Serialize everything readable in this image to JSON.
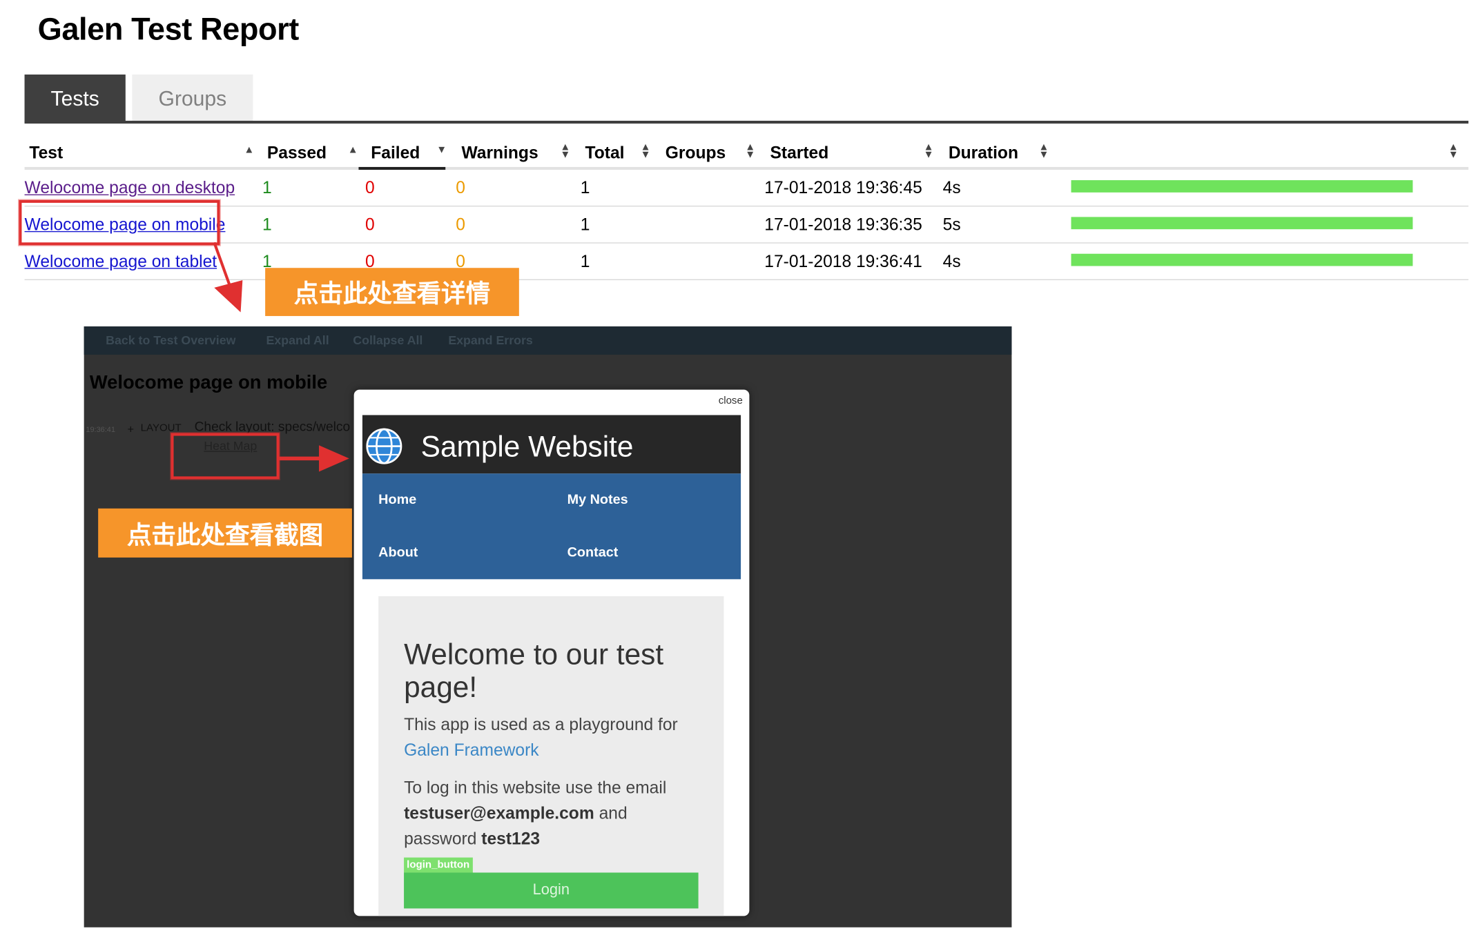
{
  "report": {
    "title": "Galen Test Report"
  },
  "tabs": [
    {
      "label": "Tests",
      "active": true
    },
    {
      "label": "Groups",
      "active": false
    }
  ],
  "table": {
    "headers": [
      "Test",
      "Passed",
      "Failed",
      "Warnings",
      "Total",
      "Groups",
      "Started",
      "Duration"
    ],
    "rows": [
      {
        "test": "Welocome page on desktop",
        "passed": "1",
        "failed": "0",
        "warnings": "0",
        "total": "1",
        "started": "17-01-2018 19:36:45",
        "duration": "4s",
        "progress": 1.0
      },
      {
        "test": "Welocome page on mobile",
        "passed": "1",
        "failed": "0",
        "warnings": "0",
        "total": "1",
        "started": "17-01-2018 19:36:35",
        "duration": "5s",
        "progress": 1.0
      },
      {
        "test": "Welocome page on tablet",
        "passed": "1",
        "failed": "0",
        "warnings": "0",
        "total": "1",
        "started": "17-01-2018 19:36:41",
        "duration": "4s",
        "progress": 1.0
      }
    ]
  },
  "callouts": {
    "details": "点击此处查看详情",
    "screenshot": "点击此处查看截图"
  },
  "detail": {
    "nav": [
      "Back to Test Overview",
      "Expand All",
      "Collapse All",
      "Expand Errors"
    ],
    "title": "Welocome page on mobile",
    "time": "19:36:41",
    "plus": "+",
    "tag": "LAYOUT",
    "check": "Check layout: specs/welco",
    "heatmap": "Heat Map"
  },
  "modal": {
    "close": "close",
    "site_title": "Sample Website",
    "nav": [
      "Home",
      "My Notes",
      "About",
      "Contact"
    ],
    "welcome": "Welcome to our test page!",
    "para1_prefix": "This app is used as a playground for",
    "para1_link": "Galen Framework",
    "para2_line1": "To log in this website use the email",
    "para2_email": "testuser@example.com",
    "para2_and": "and",
    "para2_password_label": "password",
    "para2_password": "test123",
    "login_tag": "login_button",
    "login_button": "Login"
  },
  "colors": {
    "tab_active": "#3f3f3f",
    "passed": "#1c8a1c",
    "failed": "#e00000",
    "warnings": "#ec9a00",
    "progress": "#6fe35c",
    "callout": "#f6952a",
    "annotation": "#e03030",
    "site_nav": "#2d6198"
  },
  "icons": [
    "sort-up-icon",
    "sort-down-icon",
    "sort-both-icon",
    "globe-icon",
    "arrow-icon"
  ]
}
